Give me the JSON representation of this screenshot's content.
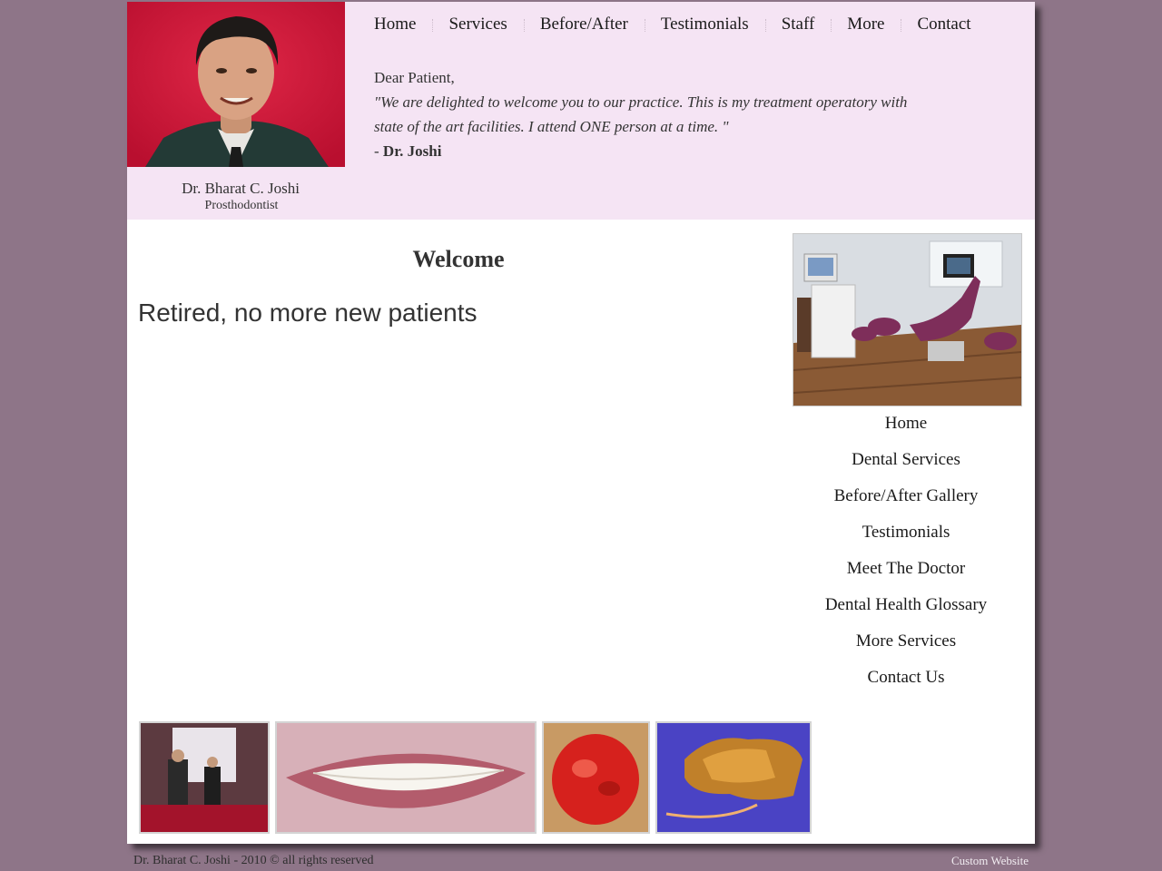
{
  "header": {
    "doctor_name": "Dr. Bharat C. Joshi",
    "doctor_title": "Prosthodontist"
  },
  "top_nav": {
    "items": [
      "Home",
      "Services",
      "Before/After",
      "Testimonials",
      "Staff",
      "More",
      "Contact"
    ]
  },
  "welcome_note": {
    "greeting": "Dear Patient,",
    "quote_line1": "\"We are delighted to welcome you to our practice. This is my treatment operatory with",
    "quote_line2": "state of the art facilities. I attend ONE person at a time. \"",
    "signature_prefix": "- ",
    "signature_name": "Dr. Joshi"
  },
  "main": {
    "heading": "Welcome",
    "notice": "Retired, no more new patients"
  },
  "side_nav": {
    "items": [
      "Home",
      "Dental Services",
      "Before/After Gallery",
      "Testimonials",
      "Meet The Doctor",
      "Dental Health Glossary",
      "More Services",
      "Contact Us"
    ]
  },
  "footer": {
    "copyright": "Dr. Bharat C. Joshi - 2010 © all rights reserved",
    "link": "Custom Website"
  },
  "colors": {
    "background": "#8e7588",
    "header_background": "#f5e4f4",
    "content_background": "#ffffff"
  }
}
